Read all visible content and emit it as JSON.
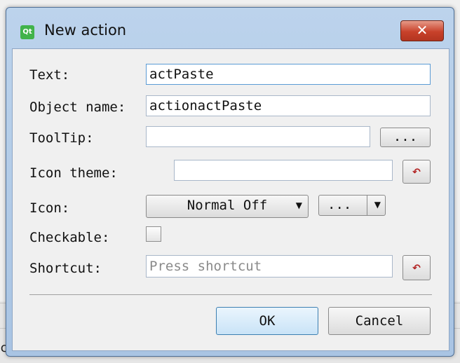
{
  "window": {
    "title": "New action",
    "app_icon": "qt-creator-icon",
    "close": "✕"
  },
  "form": {
    "text": {
      "label": "Text:",
      "value": "actPaste"
    },
    "object_name": {
      "label": "Object name:",
      "value": "actionactPaste"
    },
    "tooltip": {
      "label": "ToolTip:",
      "value": "",
      "browse_label": "..."
    },
    "icon_theme": {
      "label": "Icon theme:",
      "value": ""
    },
    "icon": {
      "label": "Icon:",
      "mode": "Normal Off",
      "browse_label": "..."
    },
    "checkable": {
      "label": "Checkable:",
      "checked": false
    },
    "shortcut": {
      "label": "Shortcut:",
      "placeholder": "Press shortcut",
      "value": ""
    }
  },
  "buttons": {
    "ok": "OK",
    "cancel": "Cancel"
  },
  "colors": {
    "titlebar": "#bcd3ec",
    "close": "#c8412a",
    "focus": "#5b9bd5"
  }
}
